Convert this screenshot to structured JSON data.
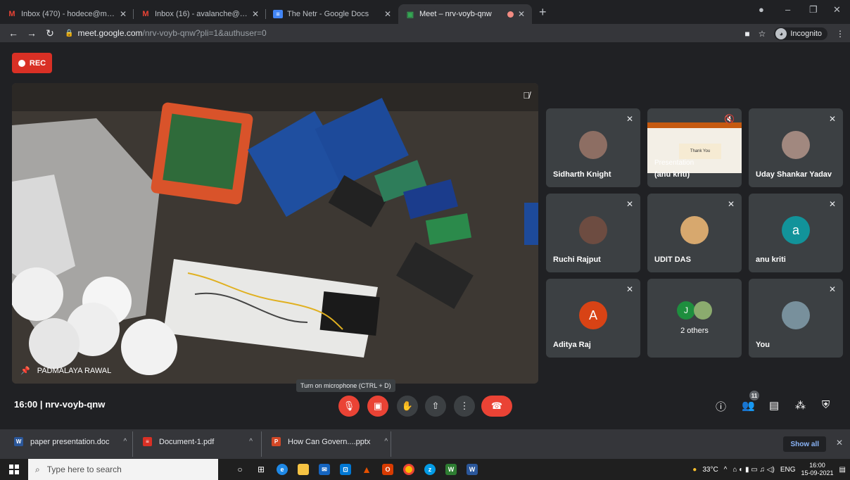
{
  "tabs": [
    {
      "title": "Inbox (470) - hodece@mmumull",
      "favicon": "gmail-icon",
      "active": false
    },
    {
      "title": "Inbox (16) - avalanche@mmumu",
      "favicon": "gmail-icon",
      "active": false
    },
    {
      "title": "The Netr - Google Docs",
      "favicon": "docs-icon",
      "active": false
    },
    {
      "title": "Meet – nrv-voyb-qnw",
      "favicon": "meet-icon",
      "active": true
    }
  ],
  "address": {
    "host": "meet.google.com",
    "path": "/nrv-voyb-qnw?pli=1&authuser=0"
  },
  "incognito_label": "Incognito",
  "rec_label": "REC",
  "main_video": {
    "name": "PADMALAYA RAWAL"
  },
  "participants": [
    {
      "name": "Sidharth Knight",
      "avatar": "photo",
      "color": "#8d6e63"
    },
    {
      "name": "(anu kriti)",
      "avatar": "presentation",
      "color": "#e0d8c8",
      "overlay": "Presentation",
      "slide_text": "Thank You"
    },
    {
      "name": "Uday Shankar Yadav",
      "avatar": "photo",
      "color": "#a1887f"
    },
    {
      "name": "Ruchi Rajput",
      "avatar": "photo",
      "color": "#6d4c41"
    },
    {
      "name": "UDIT DAS",
      "avatar": "photo",
      "color": "#d7a86e"
    },
    {
      "name": "anu kriti",
      "avatar": "a",
      "color": "#12939a"
    },
    {
      "name": "Aditya Raj",
      "avatar": "A",
      "color": "#d84315"
    },
    {
      "name": "2 others",
      "avatar": "J",
      "color": "#1e8e3e"
    },
    {
      "name": "You",
      "avatar": "photo",
      "color": "#78909c"
    }
  ],
  "meeting_info": "16:00  |  nrv-voyb-qnw",
  "tooltip": "Turn on microphone (CTRL + D)",
  "people_count": "11",
  "downloads": [
    {
      "name": "paper presentation.doc",
      "type": "doc",
      "color": "#2b579a"
    },
    {
      "name": "Document-1.pdf",
      "type": "pdf",
      "color": "#d93025"
    },
    {
      "name": "How Can Govern....pptx",
      "type": "pptx",
      "color": "#d24726"
    }
  ],
  "show_all": "Show all",
  "taskbar": {
    "search_placeholder": "Type here to search",
    "weather": "33°C",
    "lang": "ENG",
    "time": "16:00",
    "date": "15-09-2021"
  }
}
